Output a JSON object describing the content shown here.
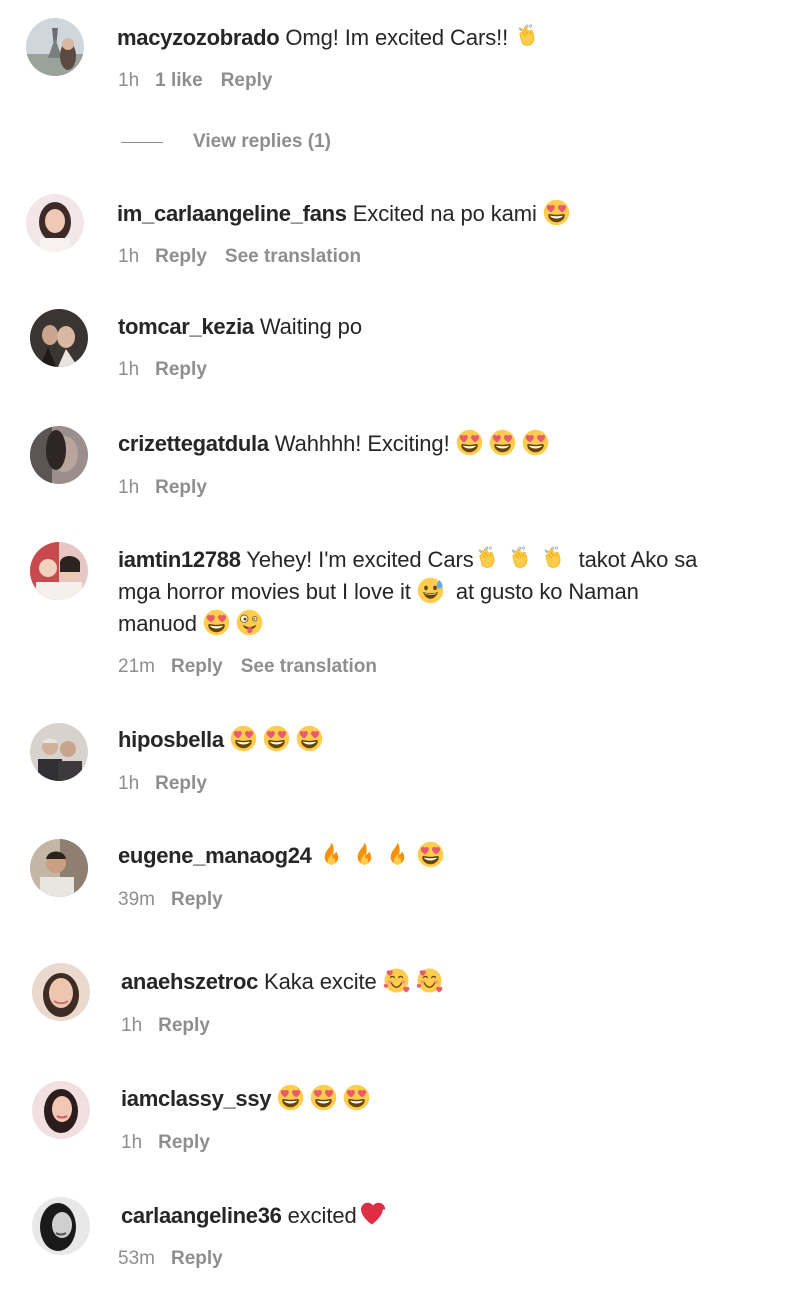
{
  "comments": [
    {
      "username": "macyzozobrado",
      "text": "Omg! Im excited Cars!!",
      "time": "1h",
      "likes": "1 like",
      "reply": "Reply",
      "view_replies": "View replies (1)",
      "icons": [
        "clapping-hands-icon"
      ]
    },
    {
      "username": "im_carlaangeline_fans",
      "text": "Excited na po kami",
      "time": "1h",
      "reply": "Reply",
      "see_translation": "See translation",
      "icons": [
        "heart-eyes-icon"
      ]
    },
    {
      "username": "tomcar_kezia",
      "text": "Waiting po",
      "time": "1h",
      "reply": "Reply"
    },
    {
      "username": "crizettegatdula",
      "text": "Wahhhh! Exciting!",
      "time": "1h",
      "reply": "Reply",
      "icons": [
        "heart-eyes-icon",
        "heart-eyes-icon",
        "heart-eyes-icon"
      ]
    },
    {
      "username": "iamtin12788",
      "text_part1": "Yehey! I'm excited Cars",
      "text_part2": "takot Ako sa",
      "text_line2_a": "mga horror movies but I love it",
      "text_line2_b": "at gusto ko Naman",
      "text_line3": "manuod",
      "time": "21m",
      "reply": "Reply",
      "see_translation": "See translation",
      "icons": [
        "clapping-hands-icon",
        "sweat-smile-icon",
        "heart-eyes-icon",
        "zany-face-icon"
      ]
    },
    {
      "username": "hiposbella",
      "time": "1h",
      "reply": "Reply",
      "icons": [
        "heart-eyes-icon",
        "heart-eyes-icon",
        "heart-eyes-icon"
      ]
    },
    {
      "username": "eugene_manaog24",
      "time": "39m",
      "reply": "Reply",
      "icons": [
        "fire-icon",
        "fire-icon",
        "fire-icon",
        "heart-eyes-icon"
      ]
    },
    {
      "username": "anaehszetroc",
      "text": "Kaka excite",
      "time": "1h",
      "reply": "Reply",
      "icons": [
        "smiling-face-with-hearts-icon",
        "smiling-face-with-hearts-icon"
      ]
    },
    {
      "username": "iamclassy_ssy",
      "time": "1h",
      "reply": "Reply",
      "icons": [
        "heart-eyes-icon",
        "heart-eyes-icon",
        "heart-eyes-icon"
      ]
    },
    {
      "username": "carlaangeline36",
      "text": "excited",
      "time": "53m",
      "reply": "Reply",
      "icons": [
        "red-heart-icon"
      ]
    }
  ],
  "colors": {
    "text": "#262626",
    "secondary": "#8e8e8e",
    "emoji_yellow": "#fcc21b",
    "heart_red": "#e0245e"
  }
}
